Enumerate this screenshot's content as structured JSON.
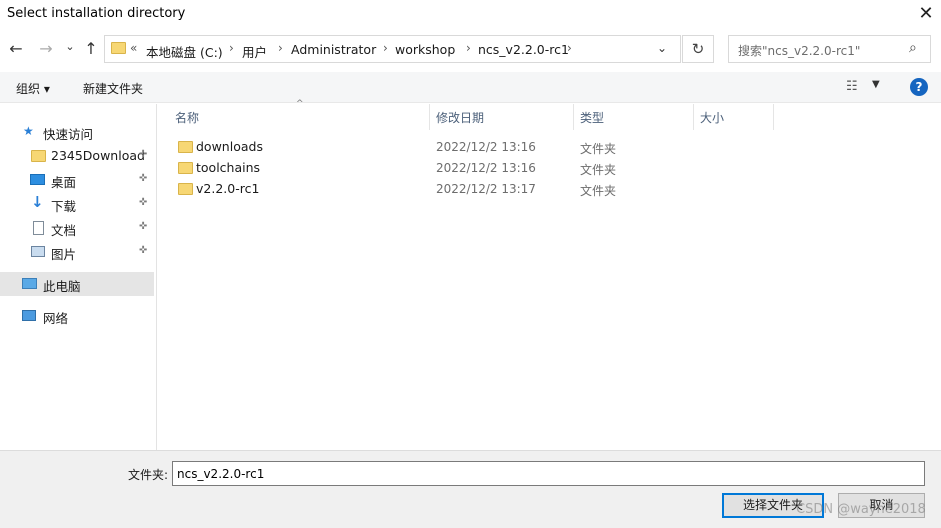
{
  "window": {
    "title": "Select installation directory",
    "close_glyph": "✕"
  },
  "nav": {
    "back": "←",
    "forward": "→",
    "recent": "⌄",
    "up": "↑"
  },
  "address": {
    "overflow": "«",
    "crumbs": [
      "本地磁盘 (C:)",
      "用户",
      "Administrator",
      "workshop",
      "ncs_v2.2.0-rc1"
    ],
    "separator": "›",
    "dropdown": "⌄",
    "refresh": "↻"
  },
  "search": {
    "placeholder": "搜索\"ncs_v2.2.0-rc1\"",
    "icon": "⌕"
  },
  "toolbar": {
    "organize": "组织 ▾",
    "new_folder": "新建文件夹",
    "view_glyph": "☷",
    "view_dd": "▼",
    "help": "?"
  },
  "sidebar": {
    "quick_access": "快速访问",
    "pinned": [
      {
        "label": "2345Download",
        "icon": "folder-icon"
      },
      {
        "label": "桌面",
        "icon": "desktop-icon"
      },
      {
        "label": "下载",
        "icon": "download-icon"
      },
      {
        "label": "文档",
        "icon": "document-icon"
      },
      {
        "label": "图片",
        "icon": "pictures-icon"
      }
    ],
    "this_pc": "此电脑",
    "network": "网络",
    "pin_glyph": "📌"
  },
  "columns": {
    "name": "名称",
    "modified": "修改日期",
    "type": "类型",
    "size": "大小",
    "sort_glyph": "^"
  },
  "files": [
    {
      "name": "downloads",
      "modified": "2022/12/2 13:16",
      "type": "文件夹"
    },
    {
      "name": "toolchains",
      "modified": "2022/12/2 13:16",
      "type": "文件夹"
    },
    {
      "name": "v2.2.0-rc1",
      "modified": "2022/12/2 13:17",
      "type": "文件夹"
    }
  ],
  "footer": {
    "folder_label": "文件夹:",
    "folder_value": "ncs_v2.2.0-rc1",
    "select_button": "选择文件夹",
    "cancel_button": "取消",
    "watermark": "CSDN @wayne2018"
  }
}
